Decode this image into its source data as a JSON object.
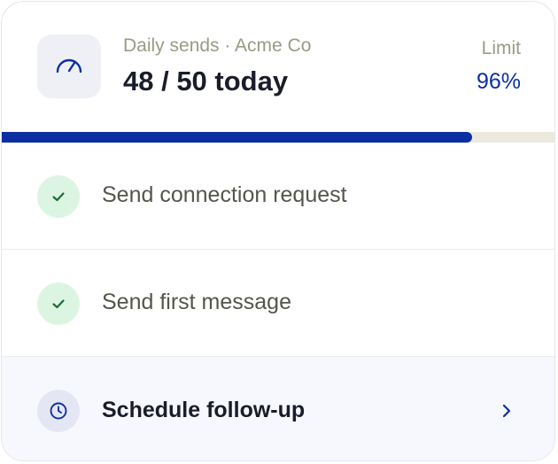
{
  "header": {
    "subtitle": "Daily sends · Acme Co",
    "headline": "48 / 50 today",
    "limit_label": "Limit",
    "limit_value": "96%",
    "icon": "gauge-icon"
  },
  "progress": {
    "sent": 48,
    "total": 50,
    "fraction": 0.96
  },
  "steps": [
    {
      "label": "Send connection request",
      "status": "done",
      "icon": "check-icon"
    },
    {
      "label": "Send first message",
      "status": "done",
      "icon": "check-icon"
    },
    {
      "label": "Schedule follow-up",
      "status": "pending",
      "icon": "clock-icon",
      "action_icon": "chevron-right-icon"
    }
  ],
  "colors": {
    "accent": "#0b2fa3",
    "success": "#1f7a3a",
    "success_bg": "#dcf5e3",
    "track": "#ece9df"
  }
}
